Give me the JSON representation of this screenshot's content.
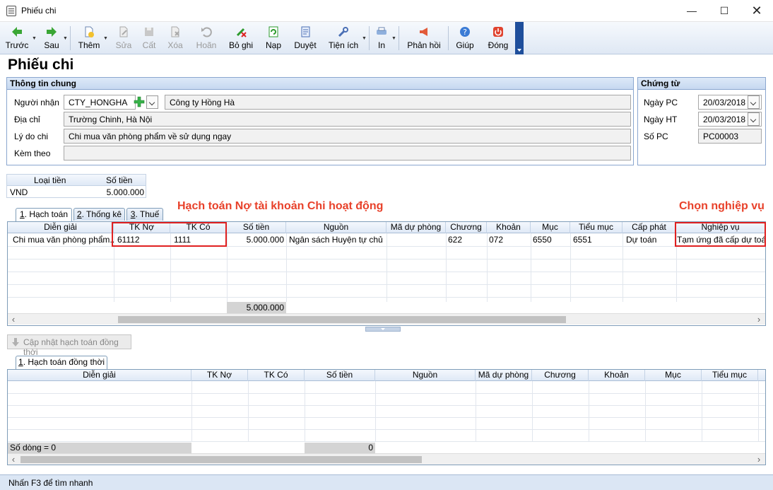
{
  "window": {
    "title": "Phiếu chi"
  },
  "toolbar": {
    "prev": "Trước",
    "next": "Sau",
    "add": "Thêm",
    "edit": "Sửa",
    "save": "Cất",
    "delete": "Xóa",
    "undo": "Hoãn",
    "unpost": "Bỏ ghi",
    "post": "Nạp",
    "approve": "Duyệt",
    "utilities": "Tiện ích",
    "print": "In",
    "feedback": "Phản hồi",
    "help": "Giúp",
    "close": "Đóng"
  },
  "page": {
    "title": "Phiếu chi"
  },
  "general": {
    "heading": "Thông tin chung",
    "recipient_label": "Người nhận",
    "recipient_code": "CTY_HONGHA",
    "recipient_name": "Công ty Hồng Hà",
    "address_label": "Địa chỉ",
    "address": "Trường Chinh, Hà Nội",
    "reason_label": "Lý do chi",
    "reason": "Chi mua văn phòng phẩm về sử dụng ngay",
    "attach_label": "Kèm theo",
    "attach": ""
  },
  "voucher": {
    "heading": "Chứng từ",
    "date_pc_label": "Ngày PC",
    "date_pc": "20/03/2018",
    "date_ht_label": "Ngày HT",
    "date_ht": "20/03/2018",
    "number_label": "Số PC",
    "number": "PC00003"
  },
  "currency": {
    "col_type": "Loại tiền",
    "col_amount": "Số tiền",
    "type": "VND",
    "amount": "5.000.000"
  },
  "annotations": {
    "left": "Hạch toán Nợ tài khoản Chi hoạt động",
    "right": "Chọn nghiệp vụ"
  },
  "tabs": [
    {
      "underline": "1",
      "rest": ". Hạch toán"
    },
    {
      "underline": "2",
      "rest": ". Thống kê"
    },
    {
      "underline": "3",
      "rest": ". Thuế"
    }
  ],
  "grid1": {
    "headers": [
      "Diễn giải",
      "TK Nợ",
      "TK Có",
      "Số tiền",
      "Nguồn",
      "Mã dự phòng",
      "Chương",
      "Khoản",
      "Mục",
      "Tiểu mục",
      "Cấp phát",
      "Nghiệp vụ"
    ],
    "row": [
      "Chi mua văn phòng phẩm...",
      "61112",
      "1111",
      "5.000.000",
      "Ngân sách Huyện tự chủ",
      "",
      "622",
      "072",
      "6550",
      "6551",
      "Dự toán",
      "Tạm ứng đã cấp dự toán"
    ],
    "total": "5.000.000"
  },
  "update_button": "Cập nhật hạch toán đồng thời",
  "tab2": {
    "underline": "1",
    "rest": ". Hạch toán đồng thời"
  },
  "grid2": {
    "headers": [
      "Diễn giải",
      "TK Nợ",
      "TK Có",
      "Số tiền",
      "Nguồn",
      "Mã dự phòng",
      "Chương",
      "Khoản",
      "Mục",
      "Tiểu mục"
    ],
    "row_count": "Số dòng = 0",
    "total": "0"
  },
  "status": {
    "hint": "Nhấn F3 để tìm nhanh"
  }
}
